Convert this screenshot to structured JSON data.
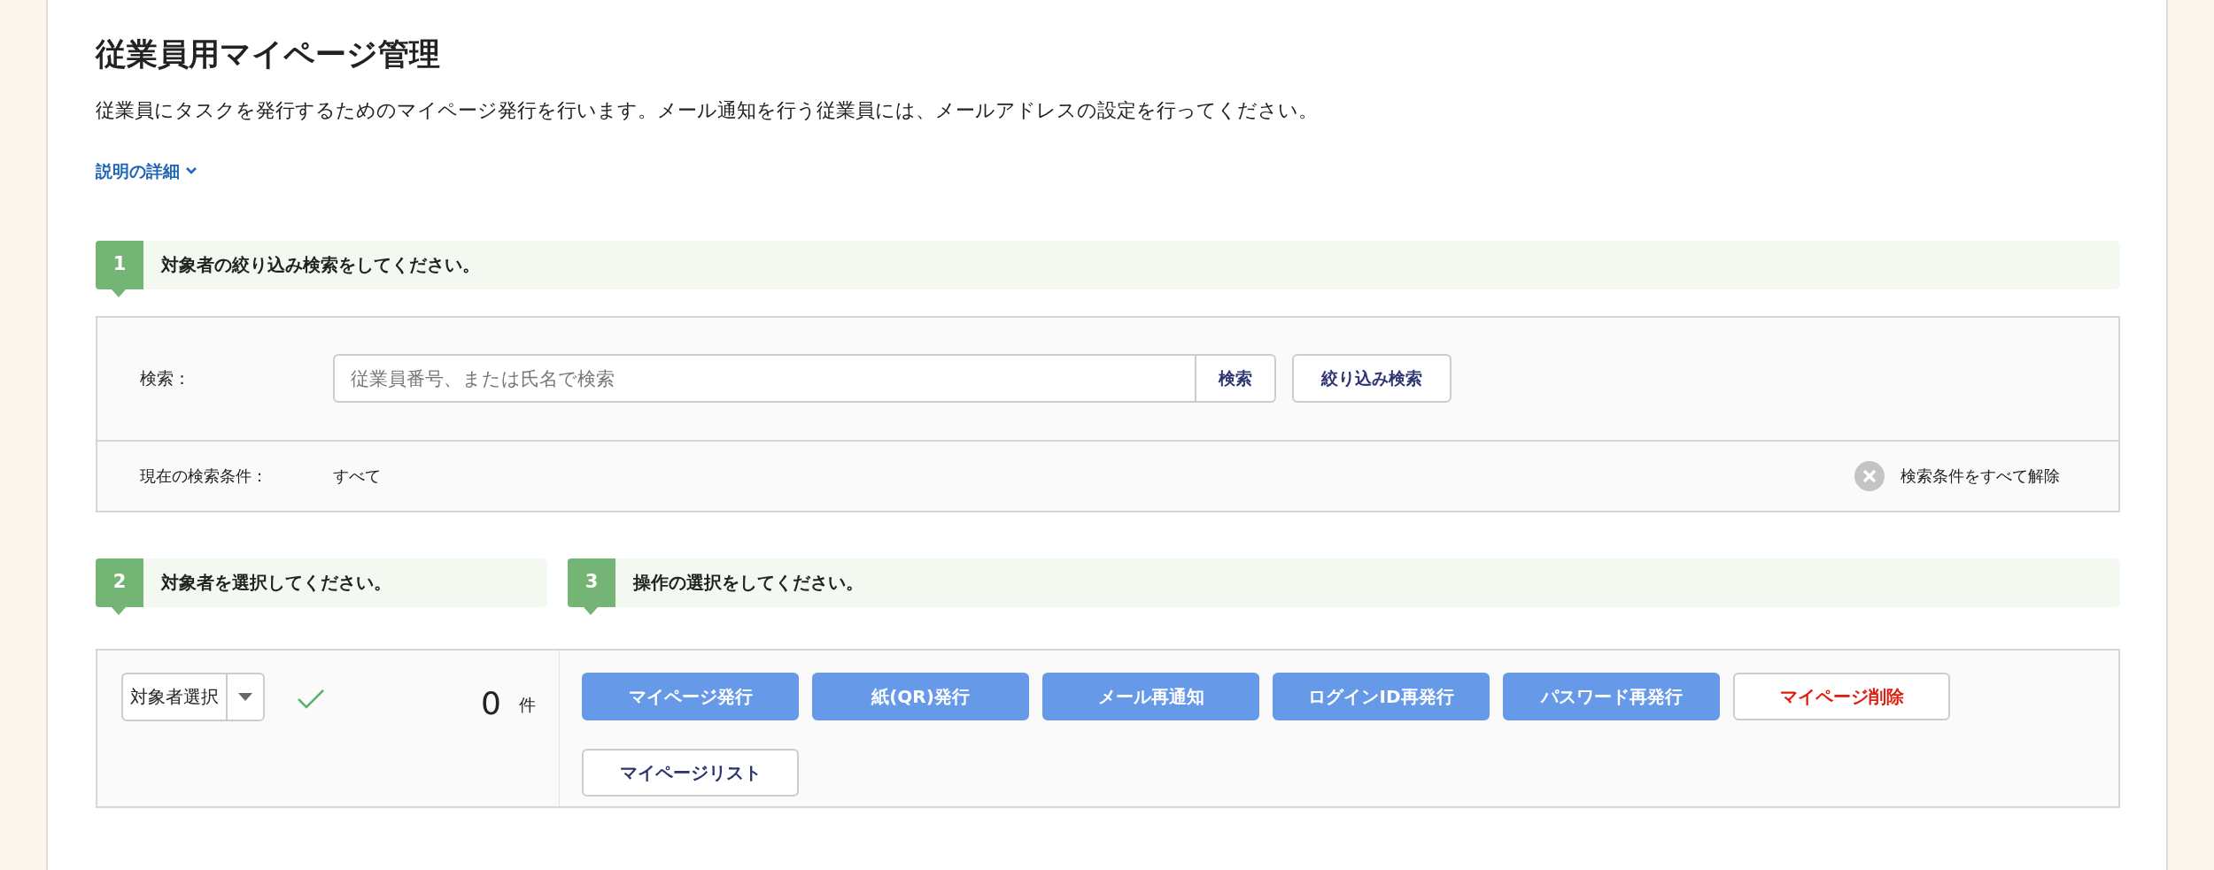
{
  "page": {
    "title": "従業員用マイページ管理",
    "description": "従業員にタスクを発行するためのマイページ発行を行います。メール通知を行う従業員には、メールアドレスの設定を行ってください。",
    "details_link": {
      "label": "説明の詳細",
      "expanded": false
    }
  },
  "step1": {
    "number": "1",
    "title": "対象者の絞り込み検索をしてください。"
  },
  "search": {
    "label": "検索：",
    "placeholder": "従業員番号、または氏名で検索",
    "search_button": "検索",
    "filter_button": "絞り込み検索",
    "conditions_label": "現在の検索条件：",
    "conditions_value": "すべて",
    "clear_label": "検索条件をすべて解除"
  },
  "step2": {
    "number": "2",
    "title": "対象者を選択してください。"
  },
  "step3": {
    "number": "3",
    "title": "操作の選択をしてください。"
  },
  "selection": {
    "dropdown": "対象者選択",
    "count": "0",
    "unit": "件"
  },
  "actions": [
    {
      "label": "マイページ発行",
      "kind": "primary"
    },
    {
      "label": "紙(QR)発行",
      "kind": "primary"
    },
    {
      "label": "メール再通知",
      "kind": "primary"
    },
    {
      "label": "ログインID再発行",
      "kind": "primary"
    },
    {
      "label": "パスワード再発行",
      "kind": "primary"
    },
    {
      "label": "マイページ削除",
      "kind": "danger"
    },
    {
      "label": "マイページリスト",
      "kind": "default"
    }
  ]
}
